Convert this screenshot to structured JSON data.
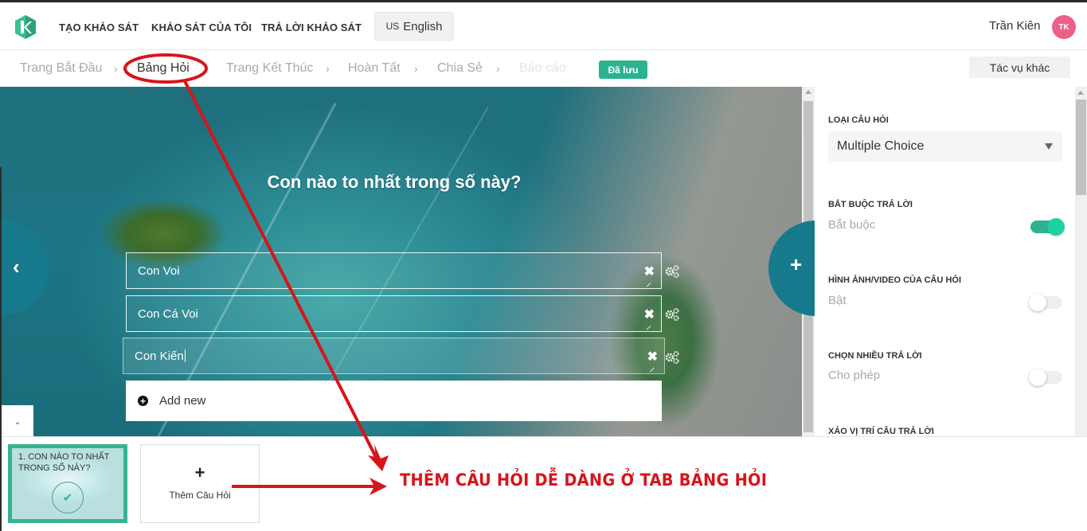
{
  "header": {
    "logo": "k-logo",
    "nav": [
      "TẠO KHẢO SÁT",
      "KHẢO SÁT CỦA TÔI",
      "TRẢ LỜI KHẢO SÁT"
    ],
    "language": {
      "flag": "US",
      "label": "English"
    },
    "user": {
      "name": "Trần Kiên",
      "initials": "TK",
      "avatar_color": "#ec5f87"
    }
  },
  "breadcrumb": {
    "items": [
      "Trang Bắt Đầu",
      "Bảng Hỏi",
      "Trang Kết Thúc",
      "Hoàn Tất",
      "Chia Sẻ",
      "Báo cáo"
    ],
    "active_index": 1,
    "separator": "›",
    "saved_badge": "Đã lưu",
    "more_actions": "Tác vụ khác"
  },
  "editor": {
    "question": "Con nào to nhất trong số này?",
    "answers": [
      "Con Voi",
      "Con Cá Voi",
      "Con Kiến"
    ],
    "focused_answer_index": 2,
    "add_new_label": "Add new",
    "prev_icon": "‹",
    "add_question_icon": "+",
    "collapse_icon": "⌄"
  },
  "settings": {
    "question_type": {
      "label": "LOẠI CÂU HỎI",
      "value": "Multiple Choice"
    },
    "required": {
      "label": "BẮT BUỘC TRẢ LỜI",
      "sub": "Bắt buộc",
      "on": true
    },
    "media": {
      "label": "HÌNH ẢNH/VIDEO CỦA CÂU HỎI",
      "sub": "Bật",
      "on": false
    },
    "multiple": {
      "label": "CHỌN NHIỀU TRẢ LỜI",
      "sub": "Cho phép",
      "on": false
    },
    "shuffle": {
      "label": "XÁO VỊ TRÍ CÂU TRẢ LỜI"
    }
  },
  "bottom": {
    "question_cards": [
      {
        "title": "1. CON NÀO TO NHẤT TRONG SỐ NÀY?",
        "status": "done"
      }
    ],
    "add_card": {
      "icon": "+",
      "label": "Thêm Câu Hỏi"
    }
  },
  "annotation": {
    "text": "THÊM CÂU HỎI DỄ DÀNG Ở TAB BẢNG HỎI",
    "color": "#d7141b"
  },
  "colors": {
    "accent": "#2bb38f",
    "teal": "#167a8c",
    "toggle_on": "#1fd1a2"
  }
}
